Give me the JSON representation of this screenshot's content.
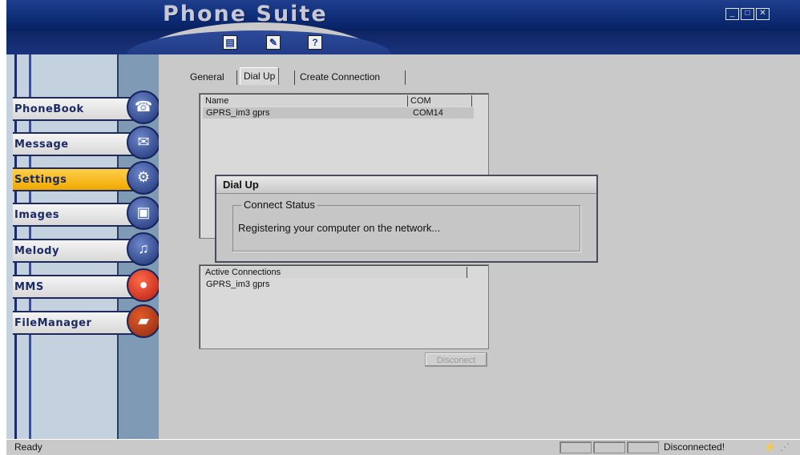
{
  "app": {
    "title": "Phone Suite",
    "window_buttons": [
      "_",
      "□",
      "✕"
    ]
  },
  "toolbar": {
    "buttons": [
      {
        "icon": "document-icon",
        "glyph": "▤"
      },
      {
        "icon": "edit-icon",
        "glyph": "✎"
      },
      {
        "icon": "help-icon",
        "glyph": "?"
      }
    ]
  },
  "sidebar": {
    "items": [
      {
        "label": "PhoneBook",
        "icon": "phone-icon",
        "glyph": "☎",
        "active": false
      },
      {
        "label": "Message",
        "icon": "envelope-icon",
        "glyph": "✉",
        "active": false
      },
      {
        "label": "Settings",
        "icon": "settings-icon",
        "glyph": "⚙",
        "active": true
      },
      {
        "label": "Images",
        "icon": "image-icon",
        "glyph": "▣",
        "active": false
      },
      {
        "label": "Melody",
        "icon": "music-icon",
        "glyph": "♫",
        "active": false
      },
      {
        "label": "MMS",
        "icon": "balloon-icon",
        "glyph": "●",
        "active": false
      },
      {
        "label": "FileManager",
        "icon": "folder-icon",
        "glyph": "▰",
        "active": false
      }
    ]
  },
  "tabs": [
    {
      "label": "General",
      "selected": false
    },
    {
      "label": "Dial Up",
      "selected": true
    },
    {
      "label": "Create Connection",
      "selected": false
    }
  ],
  "connections_list": {
    "columns": [
      "Name",
      "COM"
    ],
    "rows": [
      {
        "name": "GPRS_im3 gprs",
        "com": "COM14"
      }
    ]
  },
  "active_connections": {
    "header": "Active Connections",
    "rows": [
      "GPRS_im3 gprs"
    ]
  },
  "disconnect_button": "Disconect",
  "dialog": {
    "title": "Dial Up",
    "group_label": "Connect Status",
    "message": "Registering your computer on the network..."
  },
  "statusbar": {
    "left": "Ready",
    "right": "Disconnected!"
  }
}
